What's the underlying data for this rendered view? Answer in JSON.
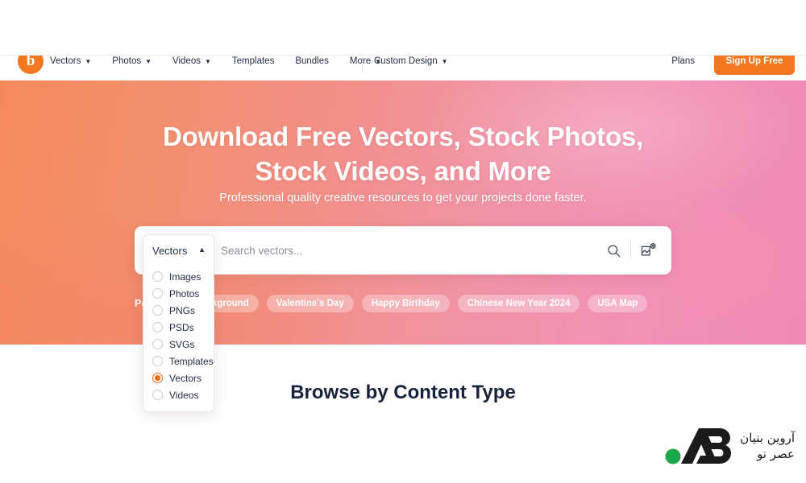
{
  "nav": {
    "logo_icon": "brand-circle-logo",
    "links": [
      {
        "label": "Vectors",
        "has_caret": true
      },
      {
        "label": "Photos",
        "has_caret": true
      },
      {
        "label": "Videos",
        "has_caret": true
      },
      {
        "label": "Templates",
        "has_caret": false
      },
      {
        "label": "Bundles",
        "has_caret": false
      },
      {
        "label": "More",
        "has_caret": true
      }
    ],
    "custom_design": {
      "label": "Custom Design",
      "has_caret": true
    },
    "plans_label": "Plans",
    "signup_label": "Sign Up Free",
    "signup_color": "#f47820"
  },
  "hero": {
    "title_line1": "Download Free Vectors, Stock Photos,",
    "title_line2": "Stock Videos, and More",
    "subtitle": "Professional quality creative resources to get your projects done faster.",
    "gradient_from": "#f4895c",
    "gradient_to": "#ef8ab4"
  },
  "search": {
    "selected_type": "Vectors",
    "placeholder": "Search vectors...",
    "value": "",
    "search_icon": "magnifier-icon",
    "image_search_icon": "image-upload-icon",
    "caret_icon": "chevron-up-icon"
  },
  "popular": {
    "label": "Popular:",
    "tags": [
      "Background",
      "Valentine's Day",
      "Happy Birthday",
      "Chinese New Year 2024",
      "USA Map"
    ]
  },
  "dropdown": {
    "header_label": "Vectors",
    "header_caret": "chevron-up-icon",
    "selected": "Vectors",
    "accent_color": "#f26b0f",
    "options": [
      "Images",
      "Photos",
      "PNGs",
      "PSDs",
      "SVGs",
      "Templates",
      "Vectors",
      "Videos"
    ]
  },
  "content_section": {
    "title": "Browse by Content Type"
  },
  "watermark": {
    "mark": "AB",
    "line1": "آروین بنیان",
    "line2": "عصر نو",
    "dot_color": "#1aa84a"
  }
}
